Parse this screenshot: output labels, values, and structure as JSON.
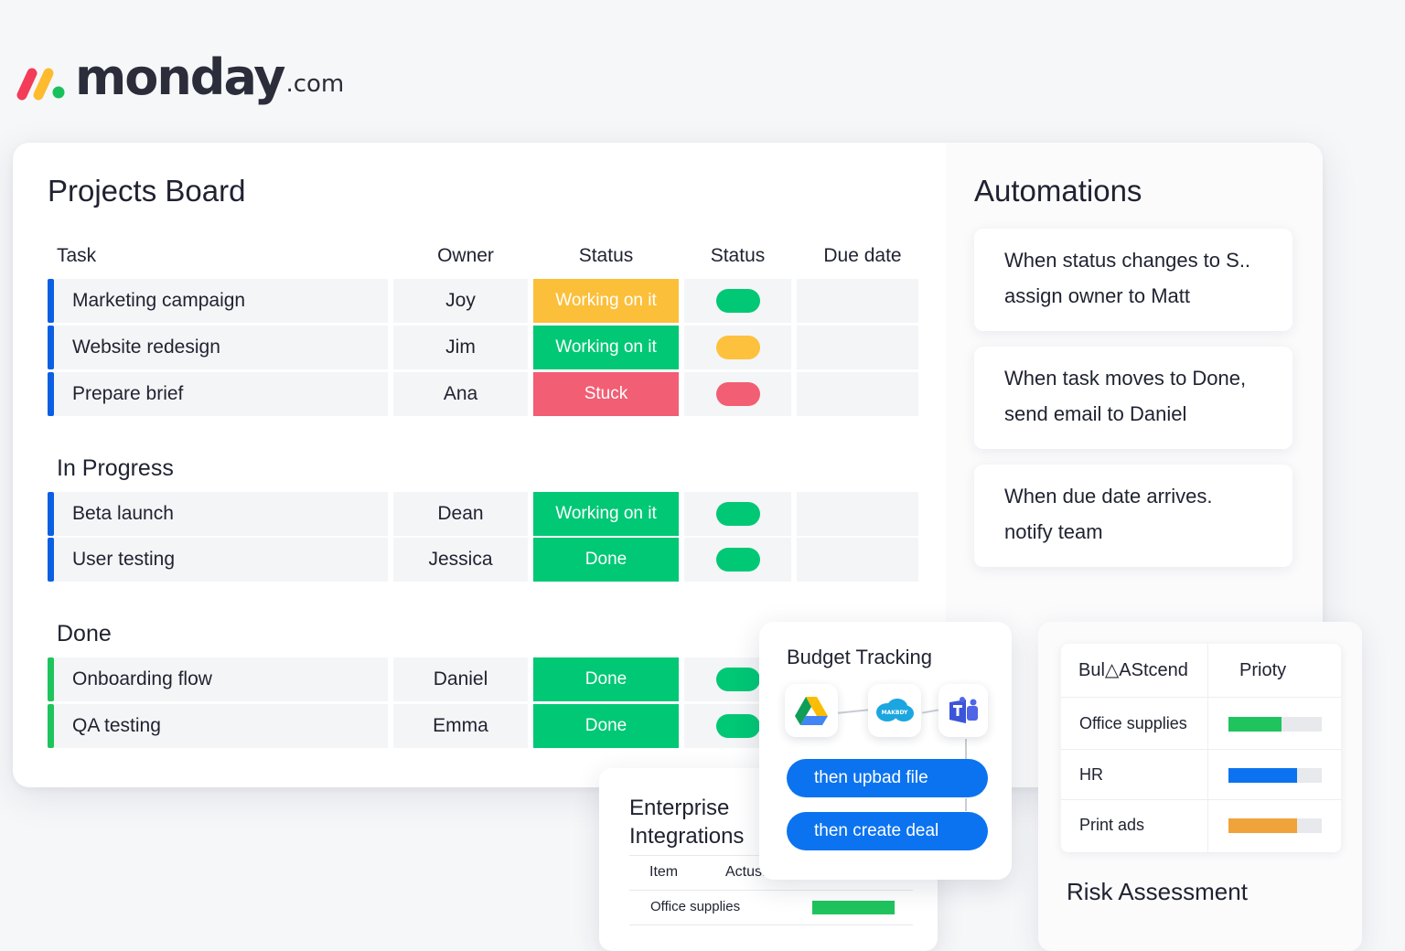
{
  "brand": {
    "name": "monday",
    "suffix": ".com"
  },
  "board": {
    "title": "Projects Board",
    "columns": {
      "task": "Task",
      "owner": "Owner",
      "status1": "Status",
      "status2": "Status",
      "due": "Due date"
    },
    "groups": [
      {
        "title": "",
        "color": "#0b5fe3",
        "rows": [
          {
            "task": "Marketing campaign",
            "owner": "Joy",
            "status": "Working on it",
            "status_color": "#fbbf3a",
            "pill_color": "#00c875"
          },
          {
            "task": "Website redesign",
            "owner": "Jim",
            "status": "Working on it",
            "status_color": "#00c875",
            "pill_color": "#fdc13d"
          },
          {
            "task": "Prepare brief",
            "owner": "Ana",
            "status": "Stuck",
            "status_color": "#f25e73",
            "pill_color": "#f25e73"
          }
        ]
      },
      {
        "title": "In Progress",
        "color": "#0b5fe3",
        "rows": [
          {
            "task": "Beta launch",
            "owner": "Dean",
            "status": "Working on it",
            "status_color": "#00c875",
            "pill_color": "#00c875"
          },
          {
            "task": "User testing",
            "owner": "Jessica",
            "status": "Done",
            "status_color": "#00c875",
            "pill_color": "#00c875"
          }
        ]
      },
      {
        "title": "Done",
        "color": "#1fc45e",
        "rows": [
          {
            "task": "Onboarding flow",
            "owner": "Daniel",
            "status": "Done",
            "status_color": "#00c875",
            "pill_color": "#00c875"
          },
          {
            "task": "QA testing",
            "owner": "Emma",
            "status": "Done",
            "status_color": "#00c875",
            "pill_color": "#00c875"
          }
        ]
      }
    ]
  },
  "automations": {
    "title": "Automations",
    "cards": [
      {
        "line1": "When status changes to S..",
        "line2": "assign owner to Matt"
      },
      {
        "line1": "When task moves to Done,",
        "line2": "send email to Daniel"
      },
      {
        "line1": "When due date arrives.",
        "line2": "notify team"
      }
    ]
  },
  "budget": {
    "title": "Budget Tracking",
    "icons": [
      "google-drive-icon",
      "salesforce-icon",
      "ms-teams-icon"
    ],
    "salesforce_label": "MAKBDY",
    "actions": [
      "then upbad file",
      "then create deal"
    ]
  },
  "enterprise": {
    "title": "Enterprise Integrations",
    "headers": [
      "Item",
      "Actus."
    ],
    "rows": [
      {
        "item": "Office supplies",
        "progress": 1.0,
        "color": "#1fc45e"
      }
    ]
  },
  "risk": {
    "title": "Risk Assessment",
    "headers": [
      "Bul△AStcend",
      "Prioty"
    ],
    "rows": [
      {
        "label": "Office supplies",
        "progress": 0.57,
        "color": "#1fc45e"
      },
      {
        "label": "HR",
        "progress": 0.74,
        "color": "#0b73f0"
      },
      {
        "label": "Print ads",
        "progress": 0.74,
        "color": "#f0a33a"
      }
    ]
  }
}
